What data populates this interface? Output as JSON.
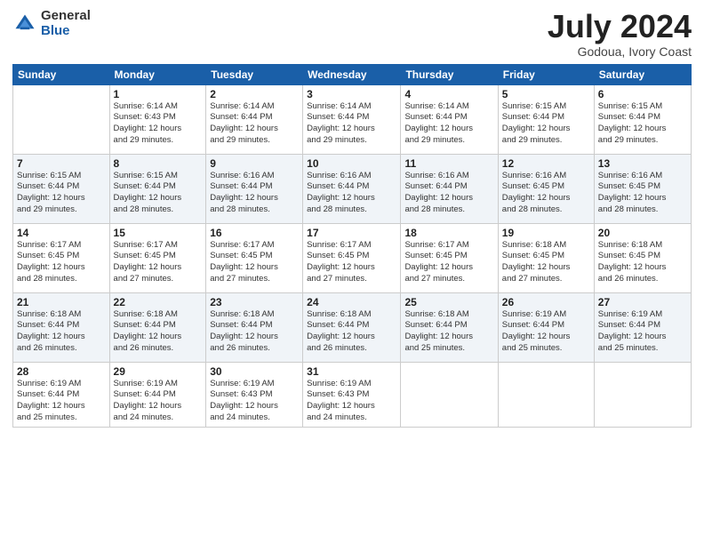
{
  "header": {
    "logo_general": "General",
    "logo_blue": "Blue",
    "month_title": "July 2024",
    "location": "Godoua, Ivory Coast"
  },
  "days_of_week": [
    "Sunday",
    "Monday",
    "Tuesday",
    "Wednesday",
    "Thursday",
    "Friday",
    "Saturday"
  ],
  "weeks": [
    [
      {
        "day": "",
        "info": ""
      },
      {
        "day": "1",
        "info": "Sunrise: 6:14 AM\nSunset: 6:43 PM\nDaylight: 12 hours\nand 29 minutes."
      },
      {
        "day": "2",
        "info": "Sunrise: 6:14 AM\nSunset: 6:44 PM\nDaylight: 12 hours\nand 29 minutes."
      },
      {
        "day": "3",
        "info": "Sunrise: 6:14 AM\nSunset: 6:44 PM\nDaylight: 12 hours\nand 29 minutes."
      },
      {
        "day": "4",
        "info": "Sunrise: 6:14 AM\nSunset: 6:44 PM\nDaylight: 12 hours\nand 29 minutes."
      },
      {
        "day": "5",
        "info": "Sunrise: 6:15 AM\nSunset: 6:44 PM\nDaylight: 12 hours\nand 29 minutes."
      },
      {
        "day": "6",
        "info": "Sunrise: 6:15 AM\nSunset: 6:44 PM\nDaylight: 12 hours\nand 29 minutes."
      }
    ],
    [
      {
        "day": "7",
        "info": "Sunrise: 6:15 AM\nSunset: 6:44 PM\nDaylight: 12 hours\nand 29 minutes."
      },
      {
        "day": "8",
        "info": "Sunrise: 6:15 AM\nSunset: 6:44 PM\nDaylight: 12 hours\nand 28 minutes."
      },
      {
        "day": "9",
        "info": "Sunrise: 6:16 AM\nSunset: 6:44 PM\nDaylight: 12 hours\nand 28 minutes."
      },
      {
        "day": "10",
        "info": "Sunrise: 6:16 AM\nSunset: 6:44 PM\nDaylight: 12 hours\nand 28 minutes."
      },
      {
        "day": "11",
        "info": "Sunrise: 6:16 AM\nSunset: 6:44 PM\nDaylight: 12 hours\nand 28 minutes."
      },
      {
        "day": "12",
        "info": "Sunrise: 6:16 AM\nSunset: 6:45 PM\nDaylight: 12 hours\nand 28 minutes."
      },
      {
        "day": "13",
        "info": "Sunrise: 6:16 AM\nSunset: 6:45 PM\nDaylight: 12 hours\nand 28 minutes."
      }
    ],
    [
      {
        "day": "14",
        "info": "Sunrise: 6:17 AM\nSunset: 6:45 PM\nDaylight: 12 hours\nand 28 minutes."
      },
      {
        "day": "15",
        "info": "Sunrise: 6:17 AM\nSunset: 6:45 PM\nDaylight: 12 hours\nand 27 minutes."
      },
      {
        "day": "16",
        "info": "Sunrise: 6:17 AM\nSunset: 6:45 PM\nDaylight: 12 hours\nand 27 minutes."
      },
      {
        "day": "17",
        "info": "Sunrise: 6:17 AM\nSunset: 6:45 PM\nDaylight: 12 hours\nand 27 minutes."
      },
      {
        "day": "18",
        "info": "Sunrise: 6:17 AM\nSunset: 6:45 PM\nDaylight: 12 hours\nand 27 minutes."
      },
      {
        "day": "19",
        "info": "Sunrise: 6:18 AM\nSunset: 6:45 PM\nDaylight: 12 hours\nand 27 minutes."
      },
      {
        "day": "20",
        "info": "Sunrise: 6:18 AM\nSunset: 6:45 PM\nDaylight: 12 hours\nand 26 minutes."
      }
    ],
    [
      {
        "day": "21",
        "info": "Sunrise: 6:18 AM\nSunset: 6:44 PM\nDaylight: 12 hours\nand 26 minutes."
      },
      {
        "day": "22",
        "info": "Sunrise: 6:18 AM\nSunset: 6:44 PM\nDaylight: 12 hours\nand 26 minutes."
      },
      {
        "day": "23",
        "info": "Sunrise: 6:18 AM\nSunset: 6:44 PM\nDaylight: 12 hours\nand 26 minutes."
      },
      {
        "day": "24",
        "info": "Sunrise: 6:18 AM\nSunset: 6:44 PM\nDaylight: 12 hours\nand 26 minutes."
      },
      {
        "day": "25",
        "info": "Sunrise: 6:18 AM\nSunset: 6:44 PM\nDaylight: 12 hours\nand 25 minutes."
      },
      {
        "day": "26",
        "info": "Sunrise: 6:19 AM\nSunset: 6:44 PM\nDaylight: 12 hours\nand 25 minutes."
      },
      {
        "day": "27",
        "info": "Sunrise: 6:19 AM\nSunset: 6:44 PM\nDaylight: 12 hours\nand 25 minutes."
      }
    ],
    [
      {
        "day": "28",
        "info": "Sunrise: 6:19 AM\nSunset: 6:44 PM\nDaylight: 12 hours\nand 25 minutes."
      },
      {
        "day": "29",
        "info": "Sunrise: 6:19 AM\nSunset: 6:44 PM\nDaylight: 12 hours\nand 24 minutes."
      },
      {
        "day": "30",
        "info": "Sunrise: 6:19 AM\nSunset: 6:43 PM\nDaylight: 12 hours\nand 24 minutes."
      },
      {
        "day": "31",
        "info": "Sunrise: 6:19 AM\nSunset: 6:43 PM\nDaylight: 12 hours\nand 24 minutes."
      },
      {
        "day": "",
        "info": ""
      },
      {
        "day": "",
        "info": ""
      },
      {
        "day": "",
        "info": ""
      }
    ]
  ]
}
